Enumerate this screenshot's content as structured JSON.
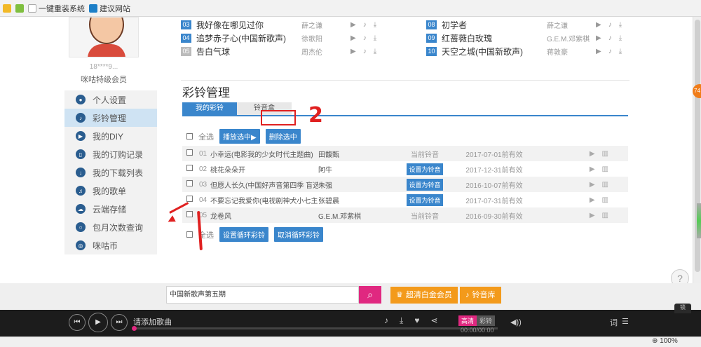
{
  "favorites": {
    "items": [
      {
        "label": "一键重装系统"
      },
      {
        "label": "建议网站"
      }
    ]
  },
  "profile": {
    "username": "18****9...",
    "level": "咪咕特级会员"
  },
  "menu": {
    "items": [
      {
        "label": "个人设置"
      },
      {
        "label": "彩铃管理"
      },
      {
        "label": "我的DIY"
      },
      {
        "label": "我的订购记录"
      },
      {
        "label": "我的下载列表"
      },
      {
        "label": "我的歌单"
      },
      {
        "label": "云端存储"
      },
      {
        "label": "包月次数查询"
      },
      {
        "label": "咪咕币"
      }
    ]
  },
  "top_songs": {
    "left": [
      {
        "num": "03",
        "name": "我好像在哪见过你",
        "artist": "薛之谦"
      },
      {
        "num": "04",
        "name": "追梦赤子心(中国新歌声)",
        "artist": "徐歌阳"
      },
      {
        "num": "05",
        "name": "告白气球",
        "artist": "周杰伦"
      }
    ],
    "right": [
      {
        "num": "08",
        "name": "初学者",
        "artist": "薛之谦"
      },
      {
        "num": "09",
        "name": "红蔷薇白玫瑰",
        "artist": "G.E.M.邓紫棋"
      },
      {
        "num": "10",
        "name": "天空之城(中国新歌声)",
        "artist": "蒋敦豪"
      }
    ]
  },
  "ringtone": {
    "title": "彩铃管理",
    "tabs": [
      {
        "label": "我的彩铃"
      },
      {
        "label": "铃音盒"
      }
    ],
    "select_all": "全选",
    "play_selected": "播放选中▶",
    "delete_selected": "删除选中",
    "set_loop": "设置循环彩铃",
    "cancel_loop": "取消循环彩铃",
    "rows": [
      {
        "num": "01",
        "name": "小幸运(电影我的少女时代主题曲)",
        "artist": "田馥甄",
        "status": "当前铃音",
        "expiry": "2017-07-01前有效"
      },
      {
        "num": "02",
        "name": "桃花朵朵开",
        "artist": "阿牛",
        "status": "设置为铃音",
        "expiry": "2017-12-31前有效"
      },
      {
        "num": "03",
        "name": "但愿人长久(中国好声音第四季 盲选...",
        "artist": "朱强",
        "status": "设置为铃音",
        "expiry": "2016-10-07前有效"
      },
      {
        "num": "04",
        "name": "不要忘记我爱你(电视剧神犬小七主...",
        "artist": "张碧晨",
        "status": "设置为铃音",
        "expiry": "2017-07-31前有效"
      },
      {
        "num": "05",
        "name": "龙卷风",
        "artist": "G.E.M.邓紫棋",
        "status": "当前铃音",
        "expiry": "2016-09-30前有效"
      }
    ]
  },
  "annotations": {
    "two": "2"
  },
  "side": {
    "badge": "74"
  },
  "search": {
    "value": "中国新歌声第五期"
  },
  "buttons": {
    "vip": "超清白金会员",
    "ringstore": "铃音库"
  },
  "player": {
    "title": "请添加歌曲",
    "hd": "高清",
    "cl": "彩铃",
    "time": "00:00/00:00",
    "lyric": "词",
    "lock": "锁"
  },
  "status": {
    "zoom": "100%"
  }
}
